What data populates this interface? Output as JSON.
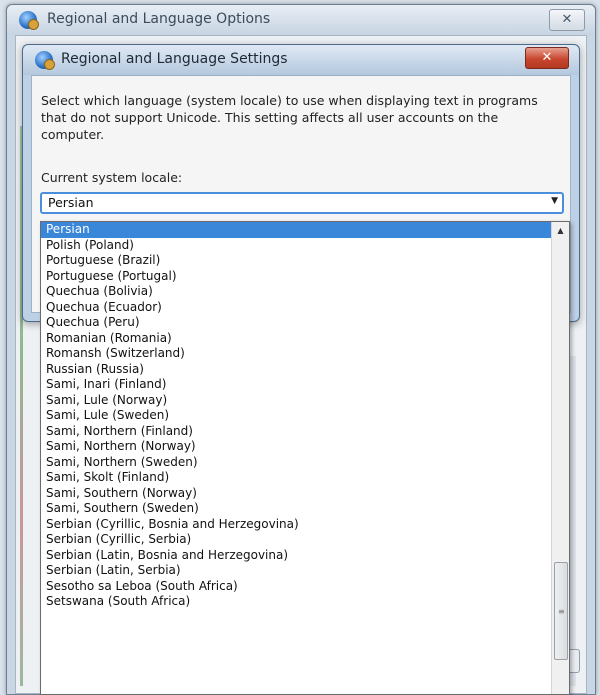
{
  "outer_window": {
    "title": "Regional and Language Options",
    "close_label": "✕"
  },
  "dialog": {
    "title": "Regional and Language Settings",
    "close_label": "✕",
    "description": "Select which language (system locale) to use when displaying text in programs that do not support Unicode. This setting affects all user accounts on the computer.",
    "locale_label": "Current system locale:",
    "selected_locale": "Persian"
  },
  "locale_options": [
    "Persian",
    "Polish (Poland)",
    "Portuguese (Brazil)",
    "Portuguese (Portugal)",
    "Quechua (Bolivia)",
    "Quechua (Ecuador)",
    "Quechua (Peru)",
    "Romanian (Romania)",
    "Romansh (Switzerland)",
    "Russian (Russia)",
    "Sami, Inari (Finland)",
    "Sami, Lule (Norway)",
    "Sami, Lule (Sweden)",
    "Sami, Northern (Finland)",
    "Sami, Northern (Norway)",
    "Sami, Northern (Sweden)",
    "Sami, Skolt (Finland)",
    "Sami, Southern (Norway)",
    "Sami, Southern (Sweden)",
    "Serbian (Cyrillic, Bosnia and Herzegovina)",
    "Serbian (Cyrillic, Serbia)",
    "Serbian (Latin, Bosnia and Herzegovina)",
    "Serbian (Latin, Serbia)",
    "Sesotho sa Leboa (South Africa)",
    "Setswana (South Africa)"
  ],
  "icons": {
    "dropdown_arrow": "▼",
    "scroll_up": "▲",
    "scroll_grip": "≡"
  },
  "colors": {
    "selection": "#3a86d8",
    "combo_border": "#4b8edb",
    "close_button": "#c8452e"
  }
}
